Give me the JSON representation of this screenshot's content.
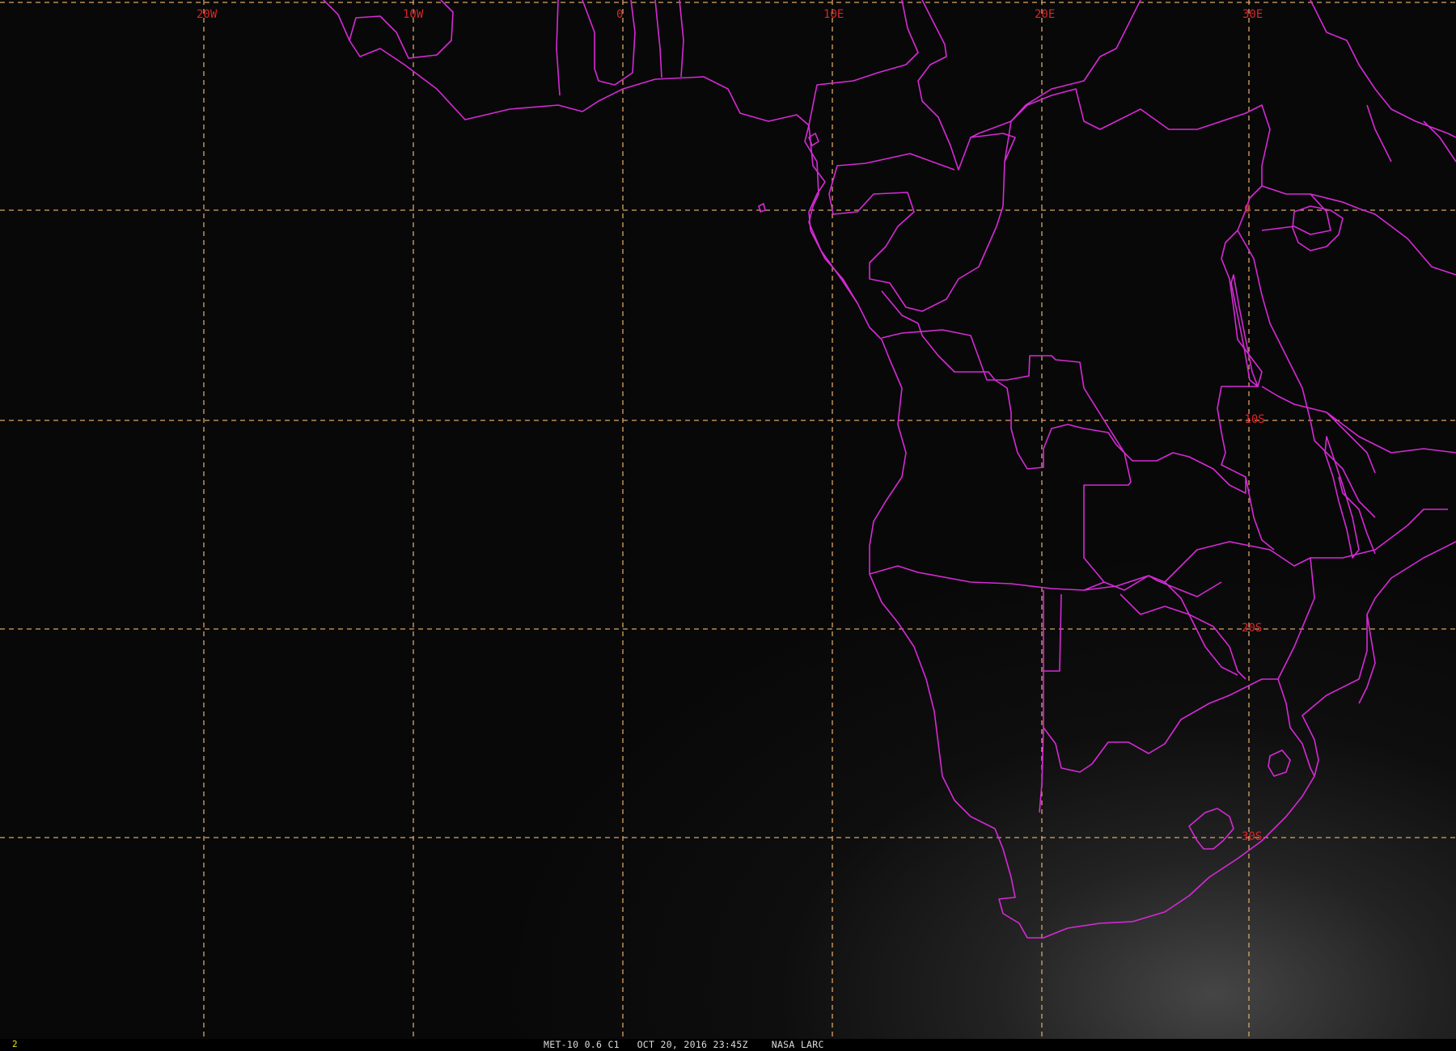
{
  "map": {
    "longitude_labels": [
      "20W",
      "10W",
      "0",
      "10E",
      "20E",
      "30E"
    ],
    "latitude_labels": [
      "0",
      "-10S",
      "20S",
      "30S"
    ],
    "colors": {
      "background": "#080808",
      "grid": "#d9a566",
      "boundaries": "#d62ad6",
      "grid_labels": "#d8262a",
      "frame_number": "#e6e61f",
      "caption": "#dcdcdc"
    }
  },
  "status_bar": {
    "frame_number": "2",
    "caption": "MET-10 0.6 C1   OCT 20, 2016 23:45Z    NASA LARC"
  }
}
